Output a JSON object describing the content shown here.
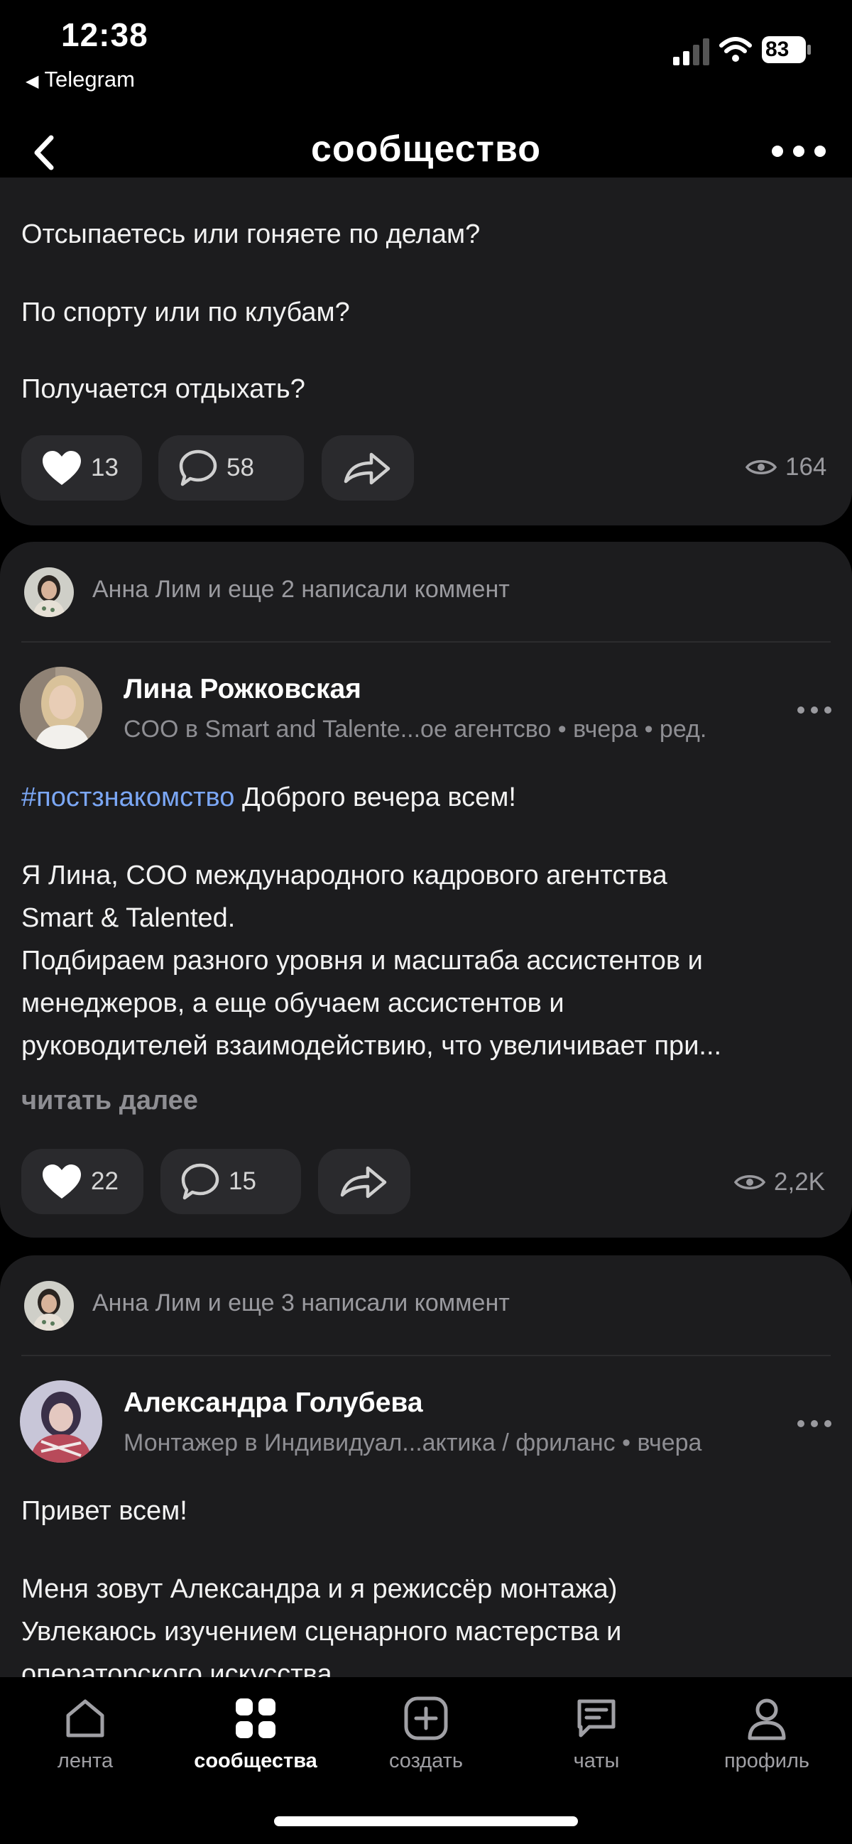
{
  "status": {
    "time": "12:38",
    "back_app": "Telegram",
    "battery": "83"
  },
  "nav": {
    "title": "сообщество"
  },
  "post1": {
    "lines": [
      "Отсыпаетесь или гоняете по делам?",
      "По спорту или по клубам?",
      "Получается отдыхать?"
    ],
    "likes": "13",
    "comments": "58",
    "views": "164"
  },
  "post2": {
    "commented_by": "Анна Лим и еще 2 написали коммент",
    "author": "Лина Рожковская",
    "subline": "COO в Smart and Talente...ое агентсво • вчера • ред.",
    "hashtag": "#постзнакомство",
    "first_line_rest": " Доброго вечера всем!",
    "body_lines": [
      "Я Лина, COO международного кадрового агентства",
      "Smart & Talented.",
      "Подбираем разного уровня и масштаба ассистентов и",
      "менеджеров, а еще обучаем ассистентов и",
      "руководителей взаимодействию, что увеличивает при..."
    ],
    "read_more": "читать далее",
    "likes": "22",
    "comments": "15",
    "views": "2,2K"
  },
  "post3": {
    "commented_by": "Анна Лим и еще 3 написали коммент",
    "author": "Александра Голубева",
    "subline": "Монтажер в Индивидуал...актика / фриланс • вчера",
    "greeting": "Привет всем!",
    "body_lines": [
      "Меня зовут Александра и я режиссёр монтажа)",
      "Увлекаюсь изучением сценарного мастерства и",
      "операторского искусства"
    ]
  },
  "tabs": [
    {
      "label": "лента",
      "icon": "home-icon"
    },
    {
      "label": "сообщества",
      "icon": "grid-icon"
    },
    {
      "label": "создать",
      "icon": "plus-square-icon"
    },
    {
      "label": "чаты",
      "icon": "chat-icon"
    },
    {
      "label": "профиль",
      "icon": "profile-icon"
    }
  ]
}
